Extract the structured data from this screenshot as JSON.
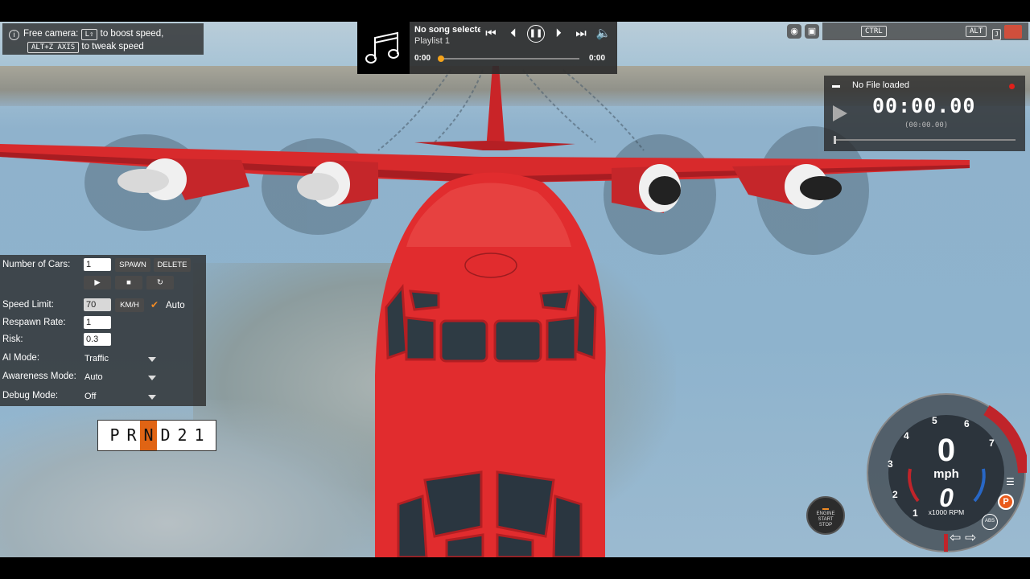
{
  "hint": {
    "line1_prefix": "Free camera:",
    "key_boost": "L⇧",
    "line1_suffix": "to boost speed,",
    "key_axis": "ALT+Z AXIS",
    "line2_suffix": "to tweak speed"
  },
  "music": {
    "title": "No song selecte",
    "playlist": "Playlist 1",
    "time_current": "0:00",
    "time_total": "0:00",
    "progress": 0
  },
  "topbar": {
    "key_ctrl": "CTRL",
    "key_alt": "ALT",
    "key_j": "J"
  },
  "timer": {
    "file": "No File loaded",
    "time": "00:00.00",
    "subtime": "(00:00.00)"
  },
  "traffic": {
    "num_cars_label": "Number of Cars:",
    "num_cars_value": "1",
    "spawn_label": "SPAWN",
    "delete_label": "DELETE",
    "speed_limit_label": "Speed Limit:",
    "speed_limit_value": "70",
    "speed_unit": "KM/H",
    "auto_label": "Auto",
    "respawn_label": "Respawn Rate:",
    "respawn_value": "1",
    "risk_label": "Risk:",
    "risk_value": "0.3",
    "ai_mode_label": "AI Mode:",
    "ai_mode_value": "Traffic",
    "awareness_label": "Awareness Mode:",
    "awareness_value": "Auto",
    "debug_label": "Debug Mode:",
    "debug_value": "Off"
  },
  "gears": {
    "items": [
      "P",
      "R",
      "N",
      "D",
      "2",
      "1"
    ],
    "active": "N"
  },
  "startstop": {
    "line1": "ENGINE",
    "line2": "START",
    "line3": "STOP"
  },
  "gauge": {
    "speed": "0",
    "unit": "mph",
    "rpm": "0",
    "rpm_label": "x1000 RPM",
    "ticks": [
      "1",
      "2",
      "3",
      "4",
      "5",
      "6",
      "7"
    ],
    "park_badge": "P",
    "abs_label": "ABS"
  }
}
